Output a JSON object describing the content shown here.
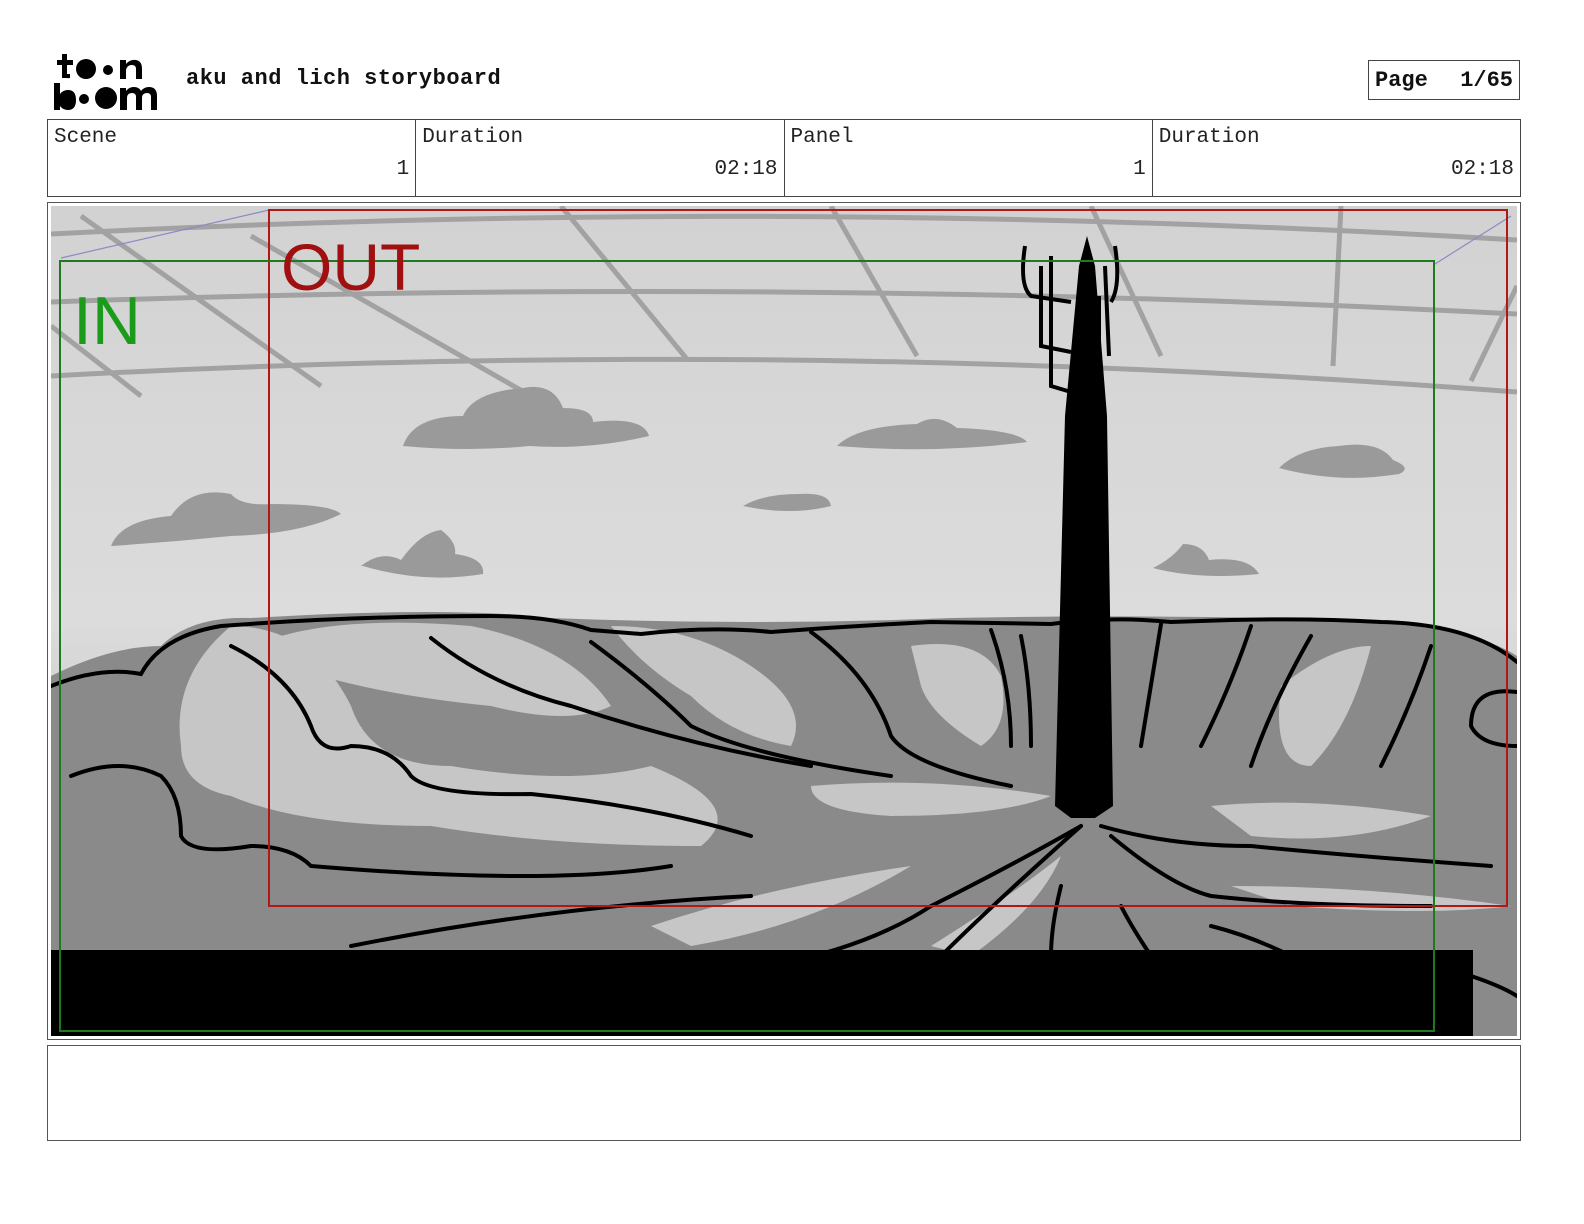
{
  "header": {
    "logo_text_top": "toon",
    "logo_text_bottom": "boom",
    "title": "aku and lich storyboard",
    "page_label": "Page",
    "page_value": "1/65"
  },
  "info": {
    "scene_label": "Scene",
    "scene_value": "1",
    "scene_duration_label": "Duration",
    "scene_duration_value": "02:18",
    "panel_label": "Panel",
    "panel_value": "1",
    "panel_duration_label": "Duration",
    "panel_duration_value": "02:18"
  },
  "panel": {
    "in_label": "IN",
    "out_label": "OUT",
    "in_color": "#1a9c1a",
    "out_color": "#a01010"
  },
  "notes": {
    "text": ""
  }
}
